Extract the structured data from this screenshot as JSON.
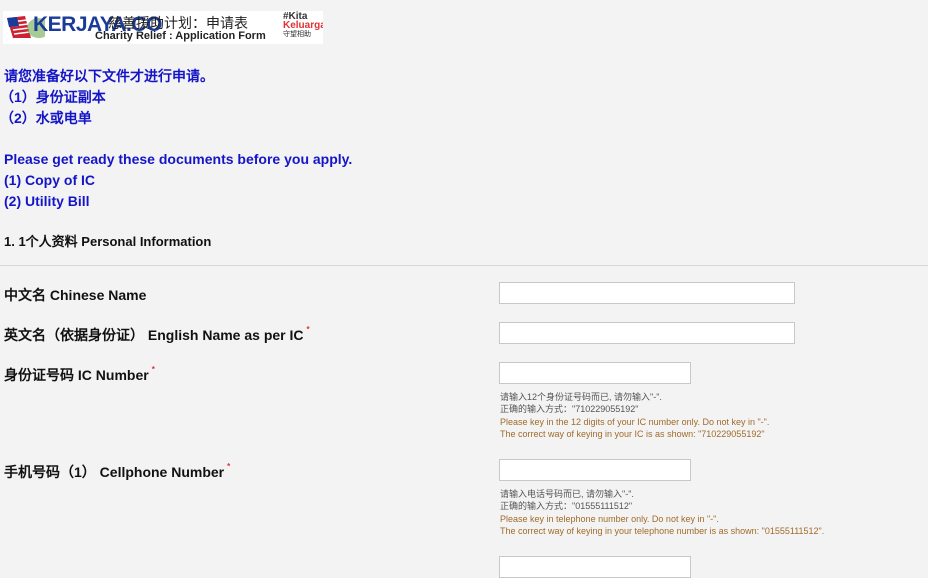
{
  "banner": {
    "logo_text": "KERJAYA.CO",
    "title_cn": "慈善援助计划：申请表",
    "title_en": "Charity Relief : Application Form",
    "badge_line1": "#Kita",
    "badge_line2": "Keluarga",
    "badge_line3": "守望相助"
  },
  "notice": {
    "cn_intro": "请您准备好以下文件才进行申请。",
    "cn_item1": "（1）身份证副本",
    "cn_item2": "（2）水或电单",
    "en_intro": "Please get ready these documents before you apply.",
    "en_item1": "(1) Copy of IC",
    "en_item2": "(2) Utility Bill"
  },
  "section_title": "1. 1个人资料 Personal Information",
  "fields": [
    {
      "label": "中文名 Chinese Name",
      "value": "",
      "required": false
    },
    {
      "label": "英文名（依据身份证） English Name as per IC",
      "value": "",
      "required": true
    },
    {
      "label": "身份证号码 IC Number",
      "value": "",
      "required": true,
      "help": [
        "请输入12个身份证号码而已, 请勿输入\"-\".",
        "正确的输入方式：\"710229055192\"",
        "Please key in the 12 digits of your IC number only. Do not key in \"-\".",
        "The correct way of keying in your IC is as shown: \"710229055192\""
      ]
    },
    {
      "label": "手机号码（1） Cellphone Number",
      "value": "",
      "required": true,
      "help": [
        "请输入电话号码而已, 请勿输入\"-\".",
        "正确的输入方式：\"01555111512\"",
        "Please key in telephone number only. Do not key in \"-\".",
        "The correct way of keying in your telephone number is as shown: \"01555111512\"."
      ]
    }
  ],
  "required_mark": "*",
  "colors": {
    "notice": "#1515c8",
    "required": "#e0303a",
    "background": "#f3f3f3"
  }
}
